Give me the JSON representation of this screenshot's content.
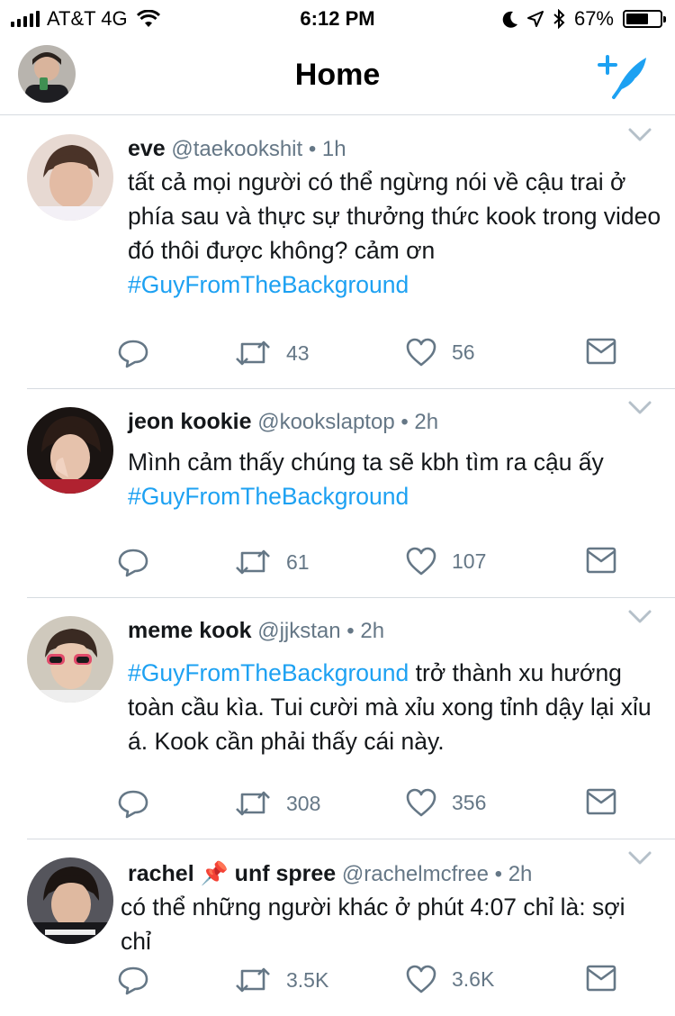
{
  "status_bar": {
    "carrier": "AT&T 4G",
    "time": "6:12 PM",
    "battery": "67%",
    "battery_level": 0.67,
    "icons": [
      "signal-icon",
      "wifi-icon",
      "moon-icon",
      "location-icon",
      "bluetooth-icon",
      "battery-icon"
    ]
  },
  "nav": {
    "title": "Home",
    "profile_icon": "avatar",
    "compose_icon": "compose-icon"
  },
  "tweets": [
    {
      "name": "eve",
      "handle": "@taekookshit",
      "dot": "•",
      "time": "1h",
      "text": "tất cả mọi người có thể ngừng nói về cậu trai ở phía sau và thực sự thưởng thức kook trong video đó thôi được không? cảm ơn",
      "hashtag": "#GuyFromTheBackground",
      "hashtag_after": "",
      "retweets": "43",
      "likes": "56",
      "avatar_color": "#c9a99a"
    },
    {
      "name": "jeon kookie",
      "handle": "@kookslaptop",
      "dot": "•",
      "time": "2h",
      "text": "Mình cảm thấy chúng ta sẽ kbh tìm ra cậu ấy",
      "hashtag": "#GuyFromTheBackground",
      "hashtag_after": "",
      "retweets": "61",
      "likes": "107",
      "avatar_color": "#3a2620"
    },
    {
      "name": "meme kook",
      "handle": "@jjkstan",
      "dot": "•",
      "time": "2h",
      "text": "",
      "hashtag": "#GuyFromTheBackground",
      "hashtag_after": " trở thành xu hướng toàn cầu kìa. Tui cười mà xỉu xong tỉnh dậy lại xỉu á. Kook cần phải thấy cái này.",
      "retweets": "308",
      "likes": "356",
      "avatar_color": "#d8d2c6"
    },
    {
      "name": "rachel 📌 unf spree",
      "handle": "@rachelmcfree",
      "dot": "•",
      "time": "2h",
      "text": "có thể những người khác ở phút 4:07 chỉ là: sợi chỉ",
      "hashtag": "",
      "hashtag_after": "",
      "retweets": "3.5K",
      "likes": "3.6K",
      "avatar_color": "#2b2b30"
    }
  ],
  "colors": {
    "accent": "#1da1f2",
    "muted": "#657786",
    "text": "#14171a",
    "divider": "#d6dbe0",
    "icon": "#657786"
  },
  "action_icons": [
    "reply-icon",
    "retweet-icon",
    "like-icon",
    "dm-icon"
  ]
}
